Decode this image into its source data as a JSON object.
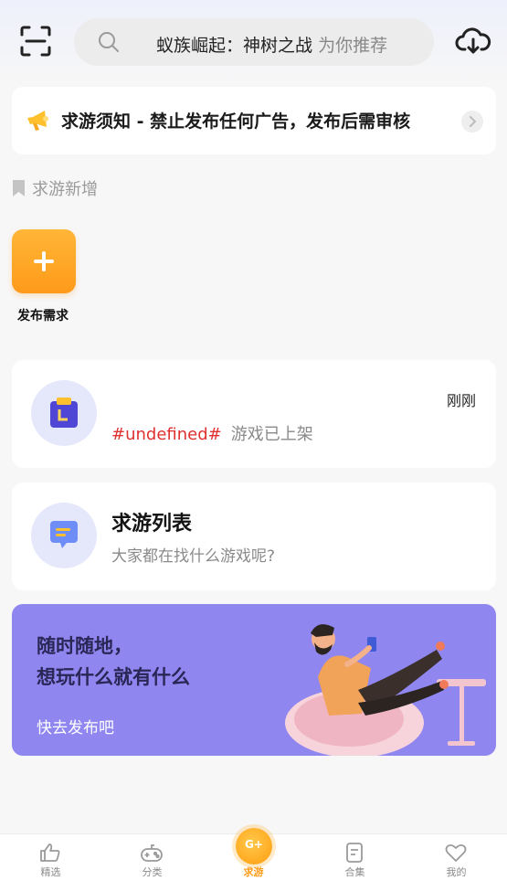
{
  "search": {
    "query": "蚁族崛起：神树之战",
    "hint": "为你推荐"
  },
  "notice": {
    "text": "求游须知 - 禁止发布任何广告，发布后需审核"
  },
  "section": {
    "title": "求游新增"
  },
  "publish": {
    "label": "发布需求"
  },
  "card_update": {
    "time": "刚刚",
    "tag": "#undefined#",
    "status": "游戏已上架"
  },
  "card_list": {
    "title": "求游列表",
    "subtitle": "大家都在找什么游戏呢?"
  },
  "banner": {
    "line1": "随时随地，",
    "line2": "想玩什么就有什么",
    "cta": "快去发布吧"
  },
  "nav": {
    "items": [
      {
        "label": "精选",
        "icon": "thumbs-up-icon"
      },
      {
        "label": "分类",
        "icon": "gamepad-icon"
      },
      {
        "label": "求游",
        "icon": "request-game-icon",
        "active": true
      },
      {
        "label": "合集",
        "icon": "collection-icon"
      },
      {
        "label": "我的",
        "icon": "heart-icon"
      }
    ]
  },
  "colors": {
    "accent": "#ff9d1a",
    "banner": "#8f86f0",
    "tag": "#e03030"
  }
}
